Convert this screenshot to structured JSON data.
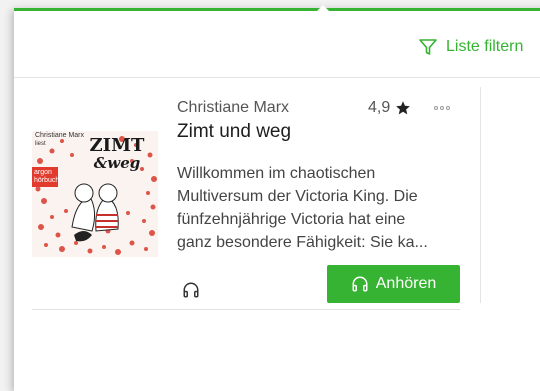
{
  "toolbar": {
    "filter_label": "Liste filtern",
    "filter_icon": "funnel-icon"
  },
  "book": {
    "author": "Christiane Marx",
    "title": "Zimt und weg",
    "rating": "4,9",
    "description_lines": [
      "Willkommen im chaotischen",
      "Multiversum der Victoria King. Die",
      "fünfzehnjährige Victoria hat eine",
      "ganz besondere Fähigkeit: Sie ka..."
    ],
    "cover": {
      "top_text": "Christiane Marx",
      "top_sub": "liest",
      "badge_line1": "argon",
      "badge_line2": "hörbuch",
      "title_line1": "ZIMT",
      "title_line2": "&weg"
    },
    "listen_label": "Anhören"
  },
  "colors": {
    "accent": "#36b332",
    "star": "#222222"
  }
}
